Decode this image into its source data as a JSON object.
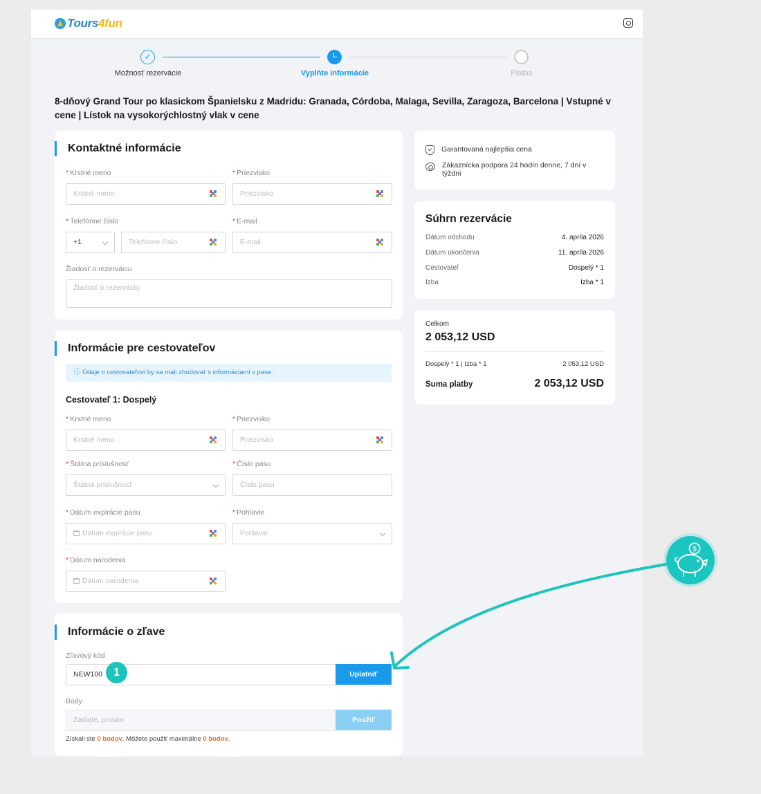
{
  "brand": {
    "logo_main": "Tours",
    "logo_accent": "4fun"
  },
  "header": {
    "icon": "support-icon"
  },
  "stepper": {
    "step1_check": "✓",
    "steps": [
      "Možnosť rezervácie",
      "Vyplňte informácie",
      "Platba"
    ]
  },
  "tour_title": "8-dňový Grand Tour po klasickom Španielsku z Madridu: Granada, Córdoba, Malaga, Sevilla, Zaragoza, Barcelona | Vstupné v cene | Lístok na vysokorýchlostný vlak v cene",
  "contact": {
    "title": "Kontaktné informácie",
    "first_name_label": "Krstné meno",
    "first_name_placeholder": "Krstné meno",
    "last_name_label": "Priezvisko",
    "last_name_placeholder": "Priezvisko",
    "phone_label": "Telefónne číslo",
    "phone_code": "+1",
    "phone_placeholder": "Telefónne číslo",
    "email_label": "E-mail",
    "email_placeholder": "E-mail",
    "request_label": "Žiadosť o rezerváciu",
    "request_placeholder": "Žiadosť o rezerváciu"
  },
  "travelers": {
    "title": "Informácie pre cestovateľov",
    "notice": "ⓘ Údaje o cestovateľovi by sa mali zhodovať s informáciami v pase.",
    "traveler_heading": "Cestovateľ 1: Dospelý",
    "first_name_label": "Krstné meno",
    "first_name_placeholder": "Krstné meno",
    "last_name_label": "Priezvisko",
    "last_name_placeholder": "Priezvisko",
    "nationality_label": "Štátna príslušnosť",
    "nationality_placeholder": "Štátna príslušnosť",
    "passport_label": "Číslo pasu",
    "passport_placeholder": "Číslo pasu",
    "expiry_label": "Dátum expirácie pasu",
    "expiry_placeholder": "Dátum expirácie pasu",
    "gender_label": "Pohlavie",
    "gender_placeholder": "Pohlavie",
    "dob_label": "Dátum narodenia",
    "dob_placeholder": "Dátum narodenia"
  },
  "discount": {
    "title": "Informácie o zľave",
    "code_label": "Zľavový kód",
    "code_value": "NEW100",
    "apply_label": "Uplatniť",
    "points_label": "Body",
    "points_placeholder": "Zadajte, prosím",
    "use_label": "Použiť",
    "note_a": "Získali ste ",
    "note_points": "0 bodov",
    "note_b": ". Môžete použiť maximálne ",
    "note_max": "0 bodov",
    "note_c": "."
  },
  "guarantees": [
    {
      "icon": "shield-icon",
      "text": "Garantovaná najlepšia cena"
    },
    {
      "icon": "headset-icon",
      "text": "Zákaznícka podpora 24 hodín denne, 7 dní v týždni"
    }
  ],
  "summary": {
    "title": "Súhrn rezervácie",
    "rows": [
      {
        "label": "Dátum odchodu",
        "value": "4. apríla 2026"
      },
      {
        "label": "Dátum ukončenia",
        "value": "11. apríla 2026"
      },
      {
        "label": "Cestovateľ",
        "value": "Dospelý * 1"
      },
      {
        "label": "Izba",
        "value": "Izba * 1"
      }
    ]
  },
  "total": {
    "label": "Celkom",
    "amount": "2 053,12 USD",
    "line_label": "Dospelý * 1 | Izba * 1",
    "line_value": "2 053,12 USD",
    "pay_label": "Suma platby",
    "pay_value": "2 053,12 USD"
  },
  "annotation": {
    "badge": "1",
    "piggy_icon": "piggy-bank-icon",
    "accent_color": "#1fc3bd"
  }
}
